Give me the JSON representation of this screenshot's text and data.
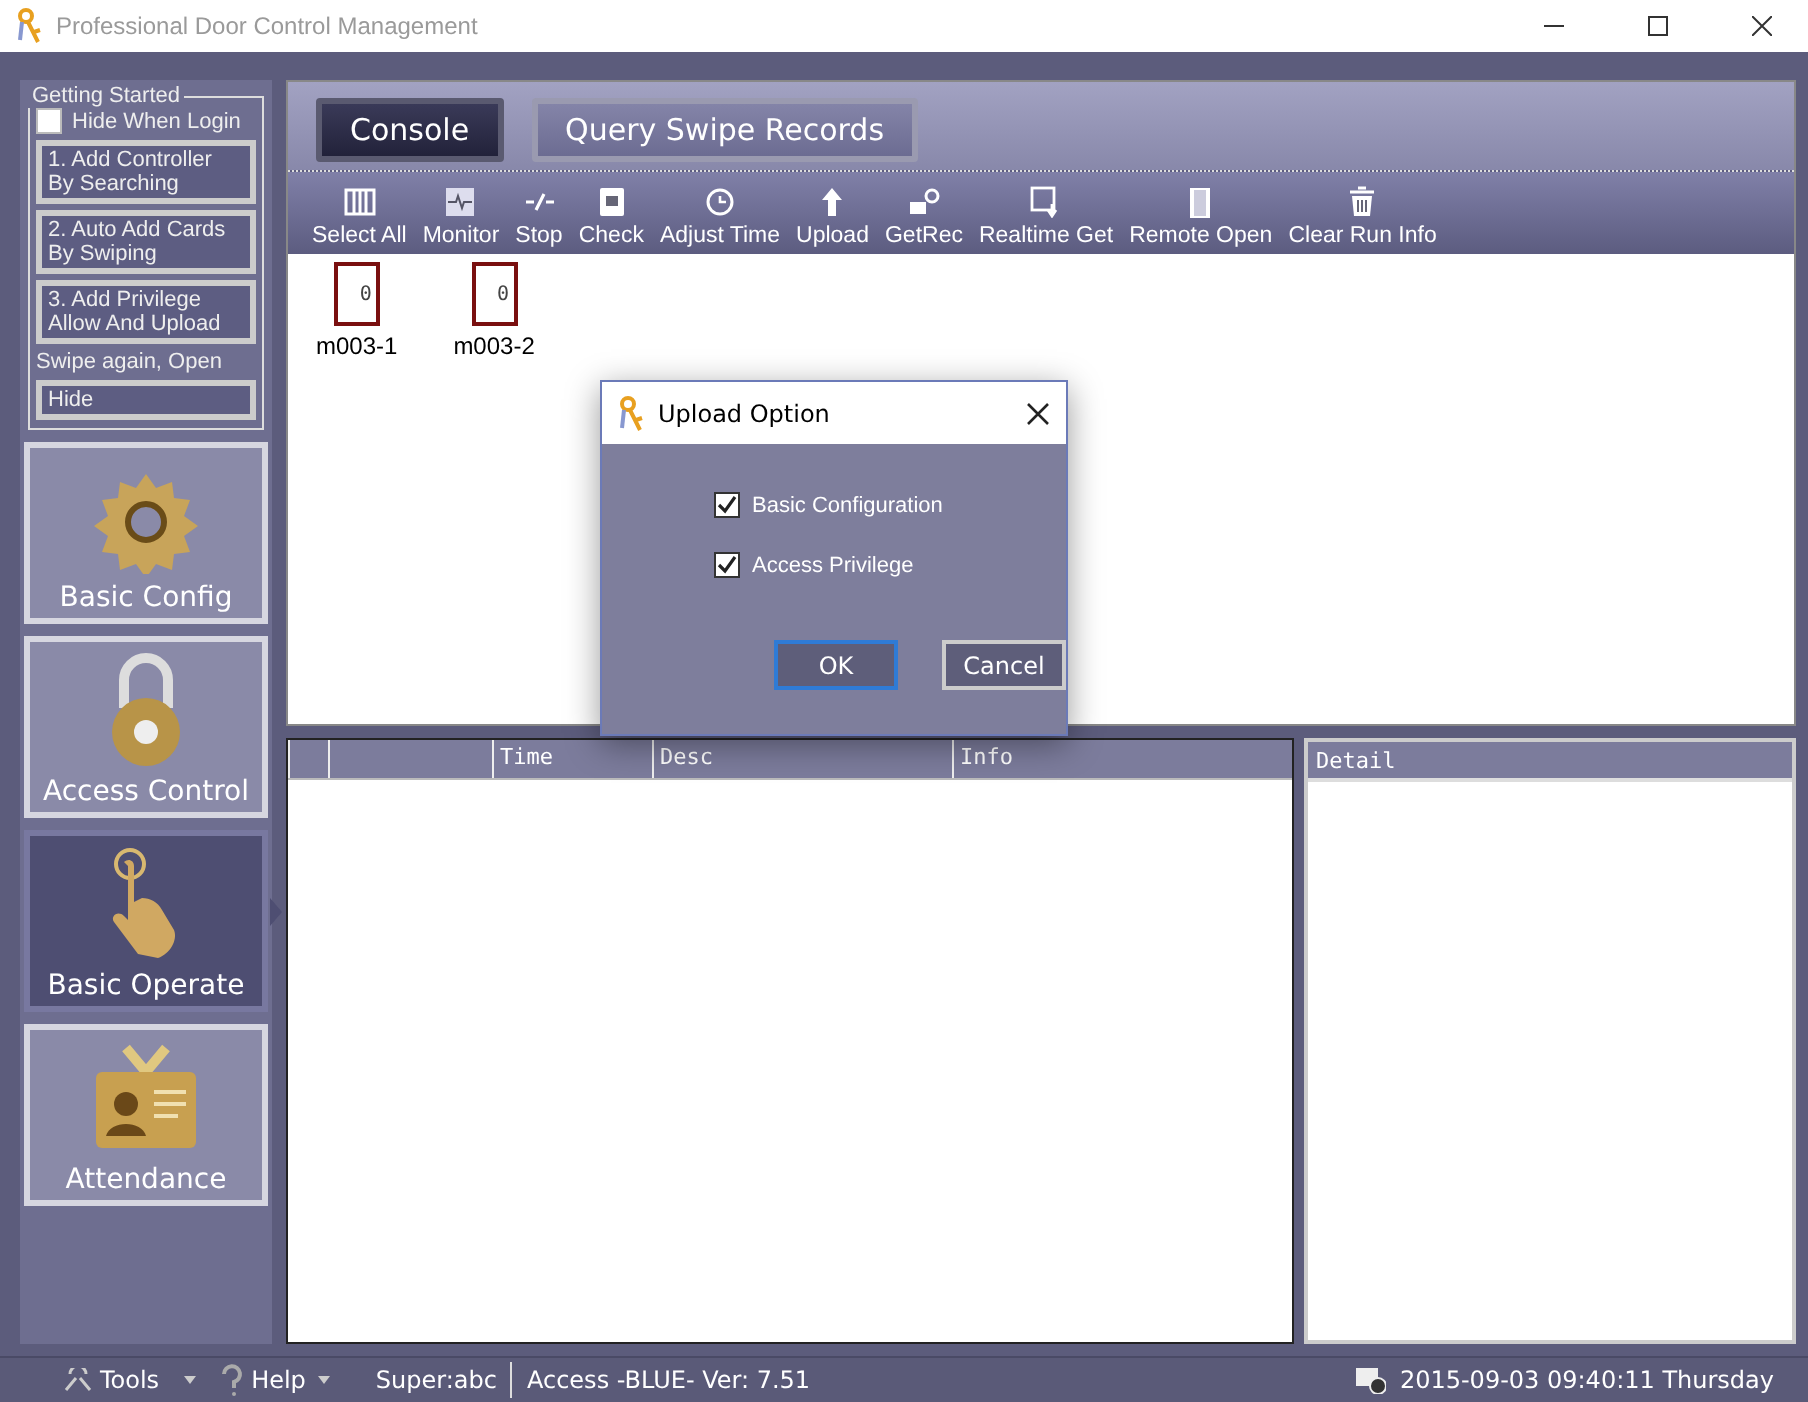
{
  "window": {
    "title": "Professional Door Control Management"
  },
  "getting_started": {
    "title": "Getting Started",
    "hide_when_login": {
      "label": "Hide When Login",
      "checked": false
    },
    "steps": [
      "1. Add Controller\nBy Searching",
      "2. Auto Add Cards\nBy Swiping",
      "3. Add Privilege\nAllow And Upload"
    ],
    "note": "Swipe again, Open",
    "hide_button": "Hide"
  },
  "nav": [
    {
      "label": "Basic Config",
      "kind": "gear",
      "selected": false
    },
    {
      "label": "Access Control",
      "kind": "lock",
      "selected": false
    },
    {
      "label": "Basic Operate",
      "kind": "hand",
      "selected": true
    },
    {
      "label": "Attendance",
      "kind": "badge",
      "selected": false
    }
  ],
  "tabs": [
    {
      "label": "Console",
      "selected": true
    },
    {
      "label": "Query Swipe Records",
      "selected": false
    }
  ],
  "toolbar": [
    {
      "label": "Select All",
      "kind": "select"
    },
    {
      "label": "Monitor",
      "kind": "monitor"
    },
    {
      "label": "Stop",
      "kind": "stop"
    },
    {
      "label": "Check",
      "kind": "check"
    },
    {
      "label": "Adjust Time",
      "kind": "clock"
    },
    {
      "label": "Upload",
      "kind": "upload"
    },
    {
      "label": "GetRec",
      "kind": "getrec"
    },
    {
      "label": "Realtime Get",
      "kind": "realtime"
    },
    {
      "label": "Remote Open",
      "kind": "door"
    },
    {
      "label": "Clear Run Info",
      "kind": "trash"
    }
  ],
  "doors": [
    {
      "name": "m003-1",
      "count": "0"
    },
    {
      "name": "m003-2",
      "count": "0"
    }
  ],
  "log_table": {
    "columns": [
      "Time",
      "Desc",
      "Info"
    ]
  },
  "detail": {
    "title": "Detail"
  },
  "dialog": {
    "title": "Upload Option",
    "options": [
      {
        "label": "Basic Configuration",
        "checked": true
      },
      {
        "label": "Access Privilege",
        "checked": true
      }
    ],
    "buttons": [
      "OK",
      "Cancel"
    ]
  },
  "status_bar": {
    "tools": "Tools",
    "help": "Help",
    "user": "Super:abc",
    "version": "Access -BLUE- Ver: 7.51",
    "datetime": "2015-09-03 09:40:11 Thursday"
  }
}
